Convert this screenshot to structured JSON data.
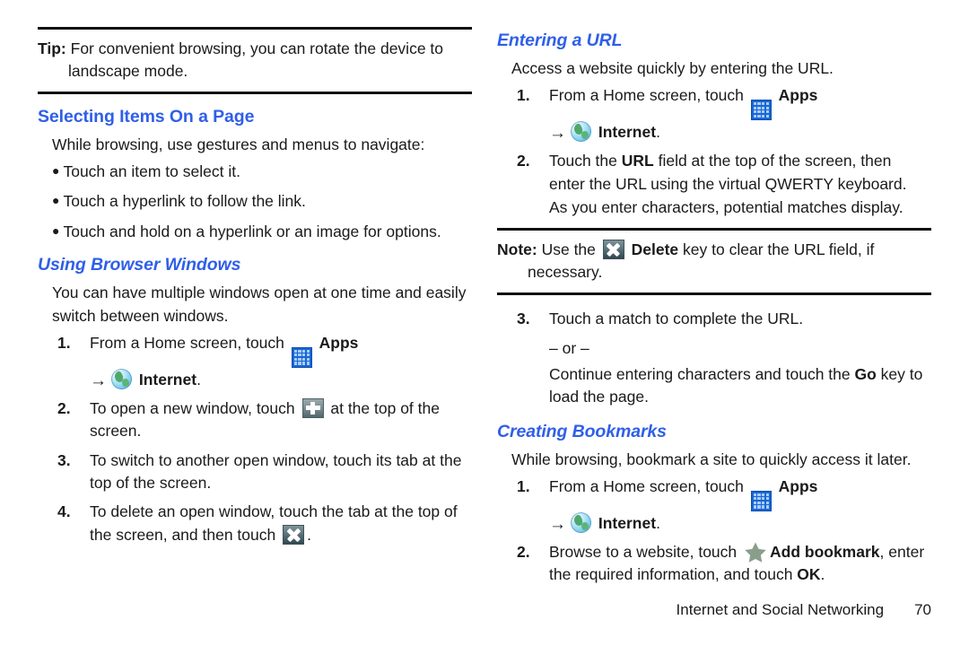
{
  "left_column": {
    "tip_callout": {
      "label": "Tip:",
      "text": " For convenient browsing, you can rotate the device to landscape mode."
    },
    "heading_selecting": "Selecting Items On a Page",
    "intro_selecting": "While browsing, use gestures and menus to navigate:",
    "bullets": [
      "Touch an item to select it.",
      "Touch a hyperlink to follow the link.",
      "Touch and hold on a hyperlink or an image for options."
    ],
    "heading_windows": "Using Browser Windows",
    "intro_windows": "You can have multiple windows open at one time and easily switch between windows.",
    "steps": [
      {
        "num": "1.",
        "text_before": "From a Home screen, touch ",
        "apps_label": "Apps",
        "sub_arrow": "→",
        "sub_label": "Internet",
        "sub_after": "."
      },
      {
        "num": "2.",
        "text_before": "To open a new window, touch ",
        "text_after": " at the top of the screen."
      },
      {
        "num": "3.",
        "text": "To switch to another open window, touch its tab at the top of the screen."
      },
      {
        "num": "4.",
        "text_before": "To delete an open window, touch the tab at the top of the screen, and then touch ",
        "text_after": "."
      }
    ]
  },
  "right_column": {
    "heading_url": "Entering a URL",
    "intro_url": "Access a website quickly by entering the URL.",
    "steps_url": [
      {
        "num": "1.",
        "text_before": "From a Home screen, touch ",
        "apps_label": "Apps",
        "sub_arrow": "→",
        "sub_label": "Internet",
        "sub_after": "."
      },
      {
        "num": "2.",
        "part1": "Touch the ",
        "bold1": "URL",
        "part2": " field at the top of the screen, then enter the URL using the virtual QWERTY keyboard.",
        "extra": "As you enter characters, potential matches display."
      }
    ],
    "note_callout": {
      "label": "Note:",
      "part1": " Use the ",
      "bold1": "Delete",
      "part2": " key to clear the URL field, if necessary."
    },
    "step3": {
      "num": "3.",
      "text": "Touch a match to complete the URL.",
      "or": "– or –",
      "continue_part1": "Continue entering characters and touch the ",
      "continue_bold": "Go",
      "continue_part2": " key to load the page."
    },
    "heading_bookmarks": "Creating Bookmarks",
    "intro_bookmarks": "While browsing, bookmark a site to quickly access it later.",
    "steps_bookmarks": [
      {
        "num": "1.",
        "text_before": "From a Home screen, touch ",
        "apps_label": "Apps",
        "sub_arrow": "→",
        "sub_label": "Internet",
        "sub_after": "."
      },
      {
        "num": "2.",
        "part1": "Browse to a website, touch ",
        "bold1": "Add bookmark",
        "part2": ", enter the required information, and touch ",
        "bold2": "OK",
        "part3": "."
      }
    ]
  },
  "footer": {
    "section": "Internet and Social Networking",
    "page_number": "70"
  },
  "colors": {
    "heading_blue": "#2f5fe8",
    "rule_black": "#111111",
    "apps_icon_blue": "#1667d8",
    "apps_icon_cell": "#a9ccf2",
    "star_sage": "#8a9e8c"
  },
  "icons": {
    "apps": "apps-grid-icon",
    "internet": "globe-internet-icon",
    "new_window": "plus-new-window-icon",
    "delete": "x-delete-icon",
    "bookmark": "star-add-bookmark-icon"
  }
}
